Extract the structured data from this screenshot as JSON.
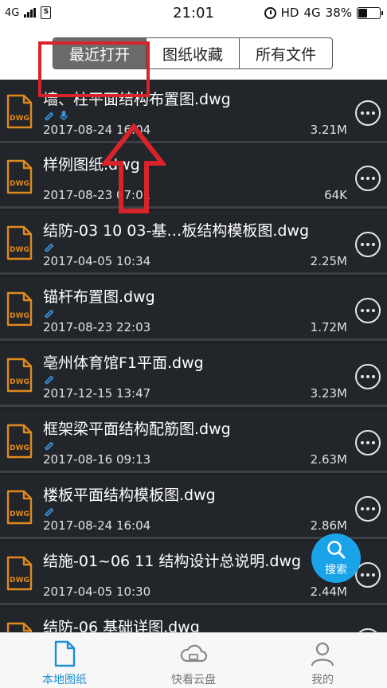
{
  "status_bar": {
    "network": "4G",
    "time": "21:01",
    "hd": "HD",
    "net_right": "4G",
    "battery_pct": "38%",
    "battery_level": 0.38
  },
  "tabs": [
    {
      "label": "最近打开",
      "active": true
    },
    {
      "label": "图纸收藏",
      "active": false
    },
    {
      "label": "所有文件",
      "active": false
    }
  ],
  "files": [
    {
      "name": "墙、柱平面结构布置图.dwg",
      "date": "2017-08-24 16:04",
      "size": "3.21M",
      "attach": true,
      "voice": true
    },
    {
      "name": "样例图纸.dwg",
      "date": "2017-08-23 07:01",
      "size": "64K",
      "attach": false,
      "voice": false
    },
    {
      "name": "结防-03 10 03-基…板结构模板图.dwg",
      "date": "2017-04-05 10:34",
      "size": "2.25M",
      "attach": true,
      "voice": false
    },
    {
      "name": "锚杆布置图.dwg",
      "date": "2017-08-23 22:03",
      "size": "1.72M",
      "attach": true,
      "voice": false
    },
    {
      "name": "亳州体育馆F1平面.dwg",
      "date": "2017-12-15 13:47",
      "size": "3.23M",
      "attach": true,
      "voice": false
    },
    {
      "name": "框架梁平面结构配筋图.dwg",
      "date": "2017-08-16 09:13",
      "size": "2.63M",
      "attach": true,
      "voice": false
    },
    {
      "name": "楼板平面结构模板图.dwg",
      "date": "2017-08-24 16:04",
      "size": "2.86M",
      "attach": true,
      "voice": false
    },
    {
      "name": "结施-01~06 11 结构设计总说明.dwg",
      "date": "2017-04-05 10:30",
      "size": "2.44M",
      "attach": false,
      "voice": false
    },
    {
      "name": "结防-06 基础详图.dwg",
      "date": "",
      "size": "",
      "attach": false,
      "voice": false
    }
  ],
  "file_icon_label": "DWG",
  "search_fab": {
    "label": "搜索"
  },
  "bottom_nav": [
    {
      "label": "本地图纸",
      "active": true,
      "icon": "document-icon"
    },
    {
      "label": "快看云盘",
      "active": false,
      "icon": "cloud-icon"
    },
    {
      "label": "我的",
      "active": false,
      "icon": "user-icon"
    }
  ],
  "colors": {
    "accent": "#1aa3e8",
    "nav_active": "#1c8fd6",
    "file_icon": "#e08a1e",
    "annotation": "#d9232b",
    "list_bg": "#22252a"
  }
}
